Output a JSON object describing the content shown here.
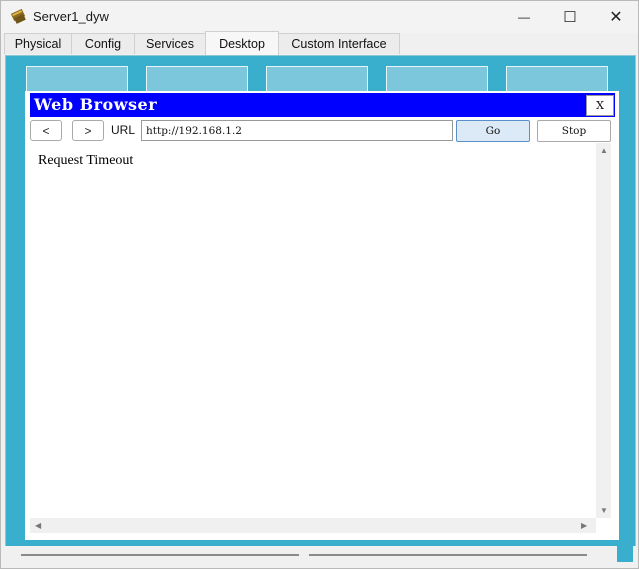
{
  "window": {
    "title": "Server1_dyw",
    "minimize_glyph": "—",
    "maximize_glyph": "☐",
    "close_glyph": "✕"
  },
  "tabs": [
    {
      "label": "Physical"
    },
    {
      "label": "Config"
    },
    {
      "label": "Services"
    },
    {
      "label": "Desktop",
      "active": true
    },
    {
      "label": "Custom Interface"
    }
  ],
  "browser": {
    "title": "Web Browser",
    "close_label": "X",
    "back_glyph": "<",
    "forward_glyph": ">",
    "url_label": "URL",
    "url_value": "http://192.168.1.2",
    "go_label": "Go",
    "stop_label": "Stop",
    "content_text": "Request Timeout"
  },
  "colors": {
    "desktop_bg": "#3aaecd",
    "browser_titlebar": "#0000ff"
  },
  "icons": [
    "app-icon",
    "minimize-icon",
    "maximize-icon",
    "close-icon",
    "scroll-up-icon",
    "scroll-down-icon",
    "scroll-left-icon",
    "scroll-right-icon"
  ]
}
